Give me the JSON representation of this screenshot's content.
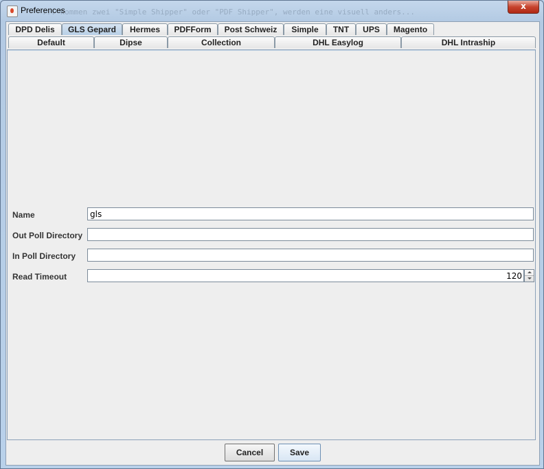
{
  "window": {
    "title": "Preferences",
    "close_label": "x",
    "background_text": "... kommen zwei \"Simple Shipper\" oder \"PDF Shipper\", werden eine visuell anders..."
  },
  "tabs": {
    "row_top": [
      {
        "label": "DPD Delis",
        "selected": false
      },
      {
        "label": "GLS Gepard",
        "selected": true
      },
      {
        "label": "Hermes",
        "selected": false
      },
      {
        "label": "PDFForm",
        "selected": false
      },
      {
        "label": "Post Schweiz",
        "selected": false
      },
      {
        "label": "Simple",
        "selected": false
      },
      {
        "label": "TNT",
        "selected": false
      },
      {
        "label": "UPS",
        "selected": false
      },
      {
        "label": "Magento",
        "selected": false
      }
    ],
    "row_bottom": [
      {
        "label": "Default"
      },
      {
        "label": "Dipse"
      },
      {
        "label": "Collection"
      },
      {
        "label": "DHL Easylog"
      },
      {
        "label": "DHL Intraship"
      }
    ]
  },
  "form": {
    "name": {
      "label": "Name",
      "value": "gls"
    },
    "out_poll_directory": {
      "label": "Out Poll Directory",
      "value": ""
    },
    "in_poll_directory": {
      "label": "In Poll Directory",
      "value": ""
    },
    "read_timeout": {
      "label": "Read Timeout",
      "value": "120"
    }
  },
  "buttons": {
    "cancel": "Cancel",
    "save": "Save"
  },
  "colors": {
    "selected_tab": "#b8cfe6",
    "panel_background": "#eeeeee",
    "frame": "#b9d1ea"
  }
}
